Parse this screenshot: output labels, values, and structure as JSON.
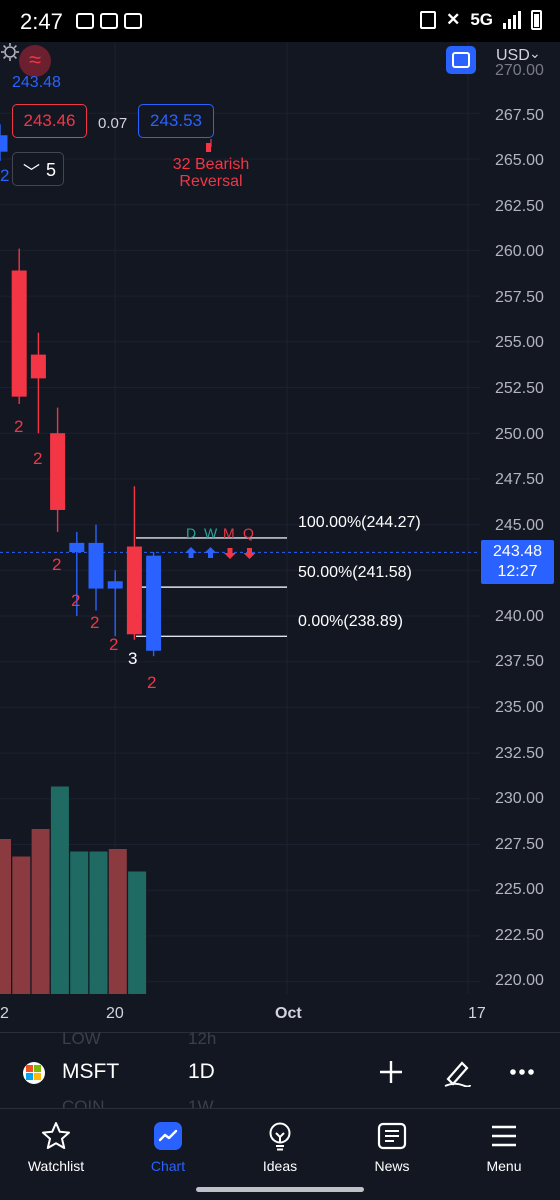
{
  "status": {
    "time": "2:47",
    "network": "5G"
  },
  "chart_header": {
    "last_price": "243.48",
    "bid": "243.46",
    "spread": "0.07",
    "ask": "243.53",
    "quantity": "5",
    "currency": "USD"
  },
  "price_axis": {
    "top_cut": "270.00",
    "labels": [
      "267.50",
      "265.00",
      "262.50",
      "260.00",
      "257.50",
      "255.00",
      "252.50",
      "250.00",
      "247.50",
      "245.00",
      "242.50",
      "240.00",
      "237.50",
      "235.00",
      "232.50",
      "230.00",
      "227.50",
      "225.00",
      "222.50",
      "220.00"
    ],
    "current_price": "243.48",
    "countdown": "12:27"
  },
  "time_axis": {
    "labels": [
      "2",
      "20",
      "Oct",
      "17"
    ]
  },
  "annotations": {
    "bearish": "32 Bearish\nReversal",
    "fib_100": "100.00%(244.27)",
    "fib_50": "50.00%(241.58)",
    "fib_0": "0.00%(238.89)",
    "signals": [
      {
        "letter": "D",
        "color": "#26a69a",
        "direction": "up"
      },
      {
        "letter": "W",
        "color": "#26a69a",
        "direction": "up"
      },
      {
        "letter": "M",
        "color": "#f23645",
        "direction": "down"
      },
      {
        "letter": "Q",
        "color": "#f23645",
        "direction": "down"
      }
    ],
    "counts": [
      "2",
      "2",
      "2",
      "2",
      "2",
      "2",
      "3",
      "2"
    ],
    "left_edge_count": "2"
  },
  "chart_data": {
    "type": "candlestick",
    "candles": [
      {
        "open": 266.3,
        "high": 266.9,
        "low": 264.9,
        "close": 265.4,
        "color": "blue"
      },
      {
        "open": 258.9,
        "high": 260.1,
        "low": 251.6,
        "close": 252.0,
        "color": "red"
      },
      {
        "open": 254.3,
        "high": 255.5,
        "low": 250.0,
        "close": 253.0,
        "color": "red"
      },
      {
        "open": 250.0,
        "high": 251.4,
        "low": 244.6,
        "close": 245.8,
        "color": "red"
      },
      {
        "open": 243.5,
        "high": 244.6,
        "low": 240.0,
        "close": 244.0,
        "color": "blue"
      },
      {
        "open": 241.5,
        "high": 245.0,
        "low": 240.3,
        "close": 244.0,
        "color": "blue"
      },
      {
        "open": 241.5,
        "high": 242.5,
        "low": 238.9,
        "close": 241.9,
        "color": "blue"
      },
      {
        "open": 243.8,
        "high": 247.1,
        "low": 238.7,
        "close": 239.0,
        "color": "red"
      },
      {
        "open": 238.1,
        "high": 243.5,
        "low": 237.8,
        "close": 243.3,
        "color": "blue"
      }
    ],
    "volume_bars": [
      {
        "level": 0.62,
        "color": "red"
      },
      {
        "level": 0.55,
        "color": "red"
      },
      {
        "level": 0.66,
        "color": "red"
      },
      {
        "level": 0.83,
        "color": "teal"
      },
      {
        "level": 0.57,
        "color": "teal"
      },
      {
        "level": 0.57,
        "color": "teal"
      },
      {
        "level": 0.58,
        "color": "red"
      },
      {
        "level": 0.49,
        "color": "teal"
      }
    ],
    "colors": {
      "up": "#2962ff",
      "down": "#f23645",
      "vol_up": "#1f6b63",
      "vol_down": "#8b3a3f"
    }
  },
  "symbol_bar": {
    "symbol": "MSFT",
    "interval": "1D",
    "ghost_top_left": "LOW",
    "ghost_top_right": "12h",
    "ghost_bottom_left": "COIN",
    "ghost_bottom_right": "1W"
  },
  "nav": {
    "items": [
      {
        "label": "Watchlist",
        "icon": "star-icon"
      },
      {
        "label": "Chart",
        "icon": "chart-icon"
      },
      {
        "label": "Ideas",
        "icon": "lightbulb-icon"
      },
      {
        "label": "News",
        "icon": "news-icon"
      },
      {
        "label": "Menu",
        "icon": "menu-icon"
      }
    ],
    "active": "Chart"
  }
}
